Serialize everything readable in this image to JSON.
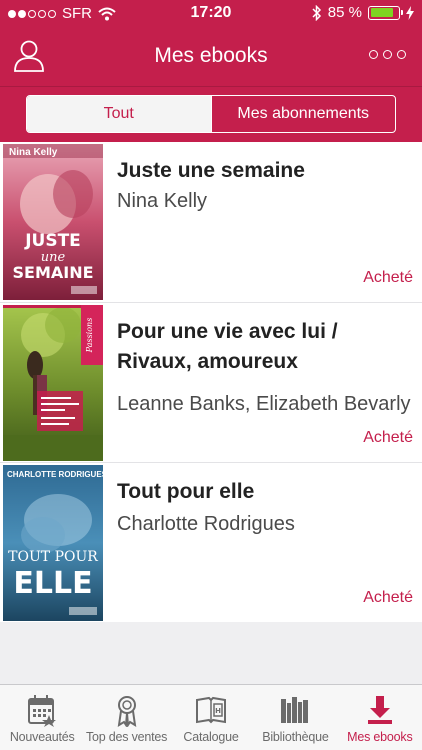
{
  "status_bar": {
    "carrier": "SFR",
    "time": "17:20",
    "battery_text": "85 %",
    "battery_level": 0.85,
    "signal_bars": 2
  },
  "header": {
    "title": "Mes ebooks",
    "left_icon": "user-icon",
    "right_icon": "more-icon"
  },
  "segment": {
    "options": [
      "Tout",
      "Mes abonnements"
    ],
    "selected": "Tout"
  },
  "books": [
    {
      "title": "Juste une semaine",
      "author": "Nina Kelly",
      "status": "Acheté",
      "cover": {
        "top_text": "Nina Kelly",
        "lines": [
          "JUSTE",
          "une",
          "SEMAINE"
        ]
      }
    },
    {
      "title": "Pour une vie avec lui / Rivaux, amoureux",
      "author": "Leanne Banks, Elizabeth Bevarly",
      "status": "Acheté",
      "cover": {
        "top_text": "Passions"
      }
    },
    {
      "title": "Tout pour elle",
      "author": "Charlotte Rodrigues",
      "status": "Acheté",
      "cover": {
        "top_text": "CHARLOTTE RODRIGUES",
        "lines": [
          "TOUT POUR",
          "ELLE"
        ]
      }
    }
  ],
  "tabbar": {
    "tabs": [
      {
        "label": "Nouveautés",
        "icon": "calendar-icon"
      },
      {
        "label": "Top des ventes",
        "icon": "award-ribbon-icon"
      },
      {
        "label": "Catalogue",
        "icon": "open-book-icon"
      },
      {
        "label": "Bibliothèque",
        "icon": "bookshelf-icon"
      },
      {
        "label": "Mes ebooks",
        "icon": "download-icon"
      }
    ],
    "active": "Mes ebooks"
  },
  "colors": {
    "brand": "#c41f4c",
    "battery": "#7ed321"
  }
}
